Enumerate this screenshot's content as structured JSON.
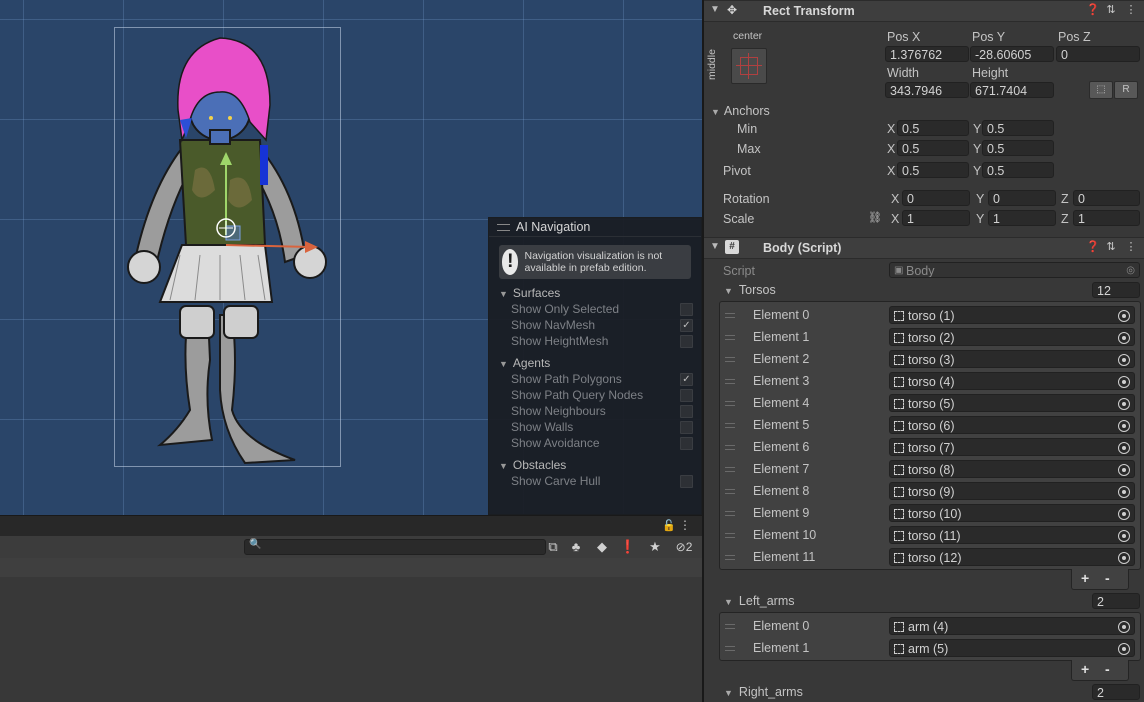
{
  "scene": {
    "nav_panel": {
      "title": "AI Navigation",
      "help_message": "Navigation visualization is not available in prefab edition.",
      "sections": [
        {
          "title": "Surfaces",
          "items": [
            {
              "label": "Show Only Selected",
              "checked": false
            },
            {
              "label": "Show NavMesh",
              "checked": true
            },
            {
              "label": "Show HeightMesh",
              "checked": false
            }
          ]
        },
        {
          "title": "Agents",
          "items": [
            {
              "label": "Show Path Polygons",
              "checked": true
            },
            {
              "label": "Show Path Query Nodes",
              "checked": false
            },
            {
              "label": "Show Neighbours",
              "checked": false
            },
            {
              "label": "Show Walls",
              "checked": false
            },
            {
              "label": "Show Avoidance",
              "checked": false
            }
          ]
        },
        {
          "title": "Obstacles",
          "items": [
            {
              "label": "Show Carve Hull",
              "checked": false
            }
          ]
        }
      ]
    }
  },
  "bottom_panel": {
    "search_placeholder": "",
    "hidden_count": "2",
    "icons": [
      "scene-search-icon",
      "filter-by-type-icon",
      "label-icon",
      "warning-icon",
      "favorite-star-icon",
      "hidden-eye-icon"
    ]
  },
  "inspector": {
    "rect_transform": {
      "title": "Rect Transform",
      "anchor_preset_h": "center",
      "anchor_preset_v": "middle",
      "pos_x_label": "Pos X",
      "pos_y_label": "Pos Y",
      "pos_z_label": "Pos Z",
      "pos_x": "1.376762",
      "pos_y": "-28.60605",
      "pos_z": "0",
      "width_label": "Width",
      "height_label": "Height",
      "width": "343.7946",
      "height": "671.7404",
      "raw_button": "R",
      "anchors_label": "Anchors",
      "min_label": "Min",
      "max_label": "Max",
      "min_x": "0.5",
      "min_y": "0.5",
      "max_x": "0.5",
      "max_y": "0.5",
      "pivot_label": "Pivot",
      "pivot_x": "0.5",
      "pivot_y": "0.5",
      "rotation_label": "Rotation",
      "rot_x": "0",
      "rot_y": "0",
      "rot_z": "0",
      "scale_label": "Scale",
      "scale_x": "1",
      "scale_y": "1",
      "scale_z": "1",
      "axis_x": "X",
      "axis_y": "Y",
      "axis_z": "Z"
    },
    "body_script": {
      "title": "Body (Script)",
      "script_label": "Script",
      "script_value": "Body",
      "torsos": {
        "label": "Torsos",
        "count": "12",
        "elements": [
          {
            "label": "Element 0",
            "value": "torso (1)"
          },
          {
            "label": "Element 1",
            "value": "torso (2)"
          },
          {
            "label": "Element 2",
            "value": "torso (3)"
          },
          {
            "label": "Element 3",
            "value": "torso (4)"
          },
          {
            "label": "Element 4",
            "value": "torso (5)"
          },
          {
            "label": "Element 5",
            "value": "torso (6)"
          },
          {
            "label": "Element 6",
            "value": "torso (7)"
          },
          {
            "label": "Element 7",
            "value": "torso (8)"
          },
          {
            "label": "Element 8",
            "value": "torso (9)"
          },
          {
            "label": "Element 9",
            "value": "torso (10)"
          },
          {
            "label": "Element 10",
            "value": "torso (11)"
          },
          {
            "label": "Element 11",
            "value": "torso (12)"
          }
        ]
      },
      "left_arms": {
        "label": "Left_arms",
        "count": "2",
        "elements": [
          {
            "label": "Element 0",
            "value": "arm (4)"
          },
          {
            "label": "Element 1",
            "value": "arm (5)"
          }
        ]
      },
      "right_arms": {
        "label": "Right_arms",
        "count": "2"
      },
      "add_label": "+",
      "remove_label": "-"
    }
  },
  "colors": {
    "scene_bg": "#2a4569",
    "panel_bg": "#383838",
    "hair": "#e84fc8",
    "skin": "#4b6fb7",
    "vest": "#4a5a2a"
  }
}
